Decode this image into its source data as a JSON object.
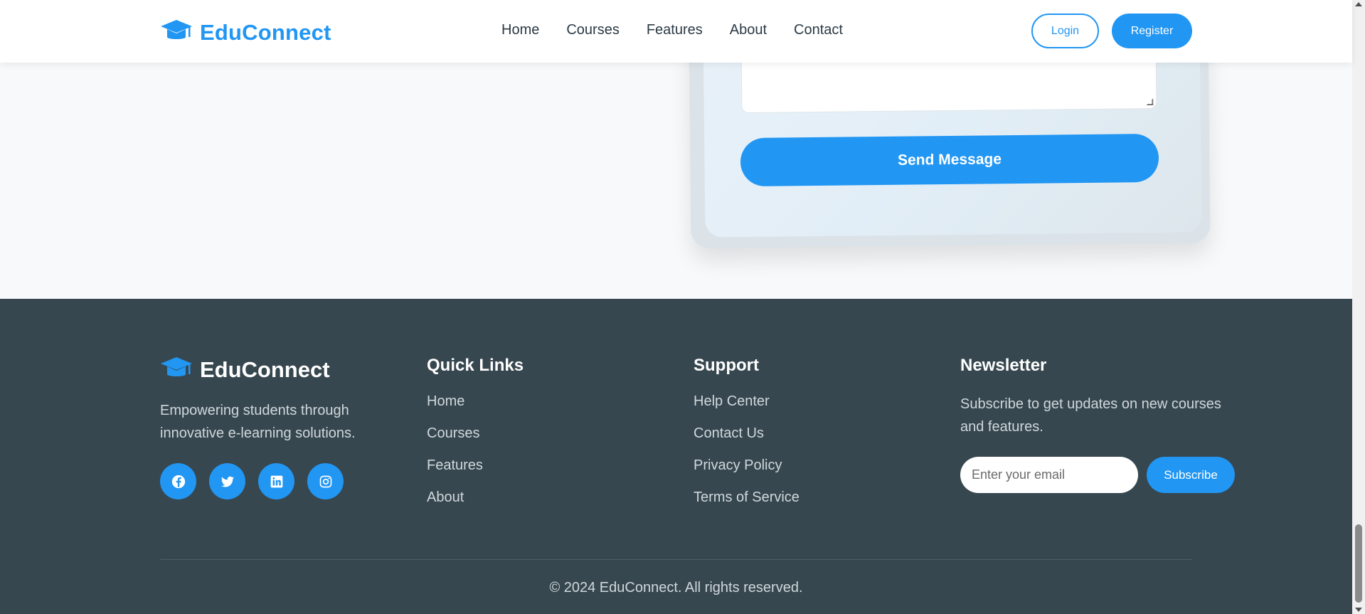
{
  "colors": {
    "accent": "#2196f3",
    "footer_bg": "#37474f",
    "page_bg": "#f7f9fb"
  },
  "header": {
    "brand": "EduConnect",
    "nav": [
      "Home",
      "Courses",
      "Features",
      "About",
      "Contact"
    ],
    "login_label": "Login",
    "register_label": "Register"
  },
  "contact_form": {
    "send_label": "Send Message"
  },
  "footer": {
    "brand": "EduConnect",
    "description": "Empowering students through innovative e-learning solutions.",
    "socials": [
      "facebook-icon",
      "twitter-icon",
      "linkedin-icon",
      "instagram-icon"
    ],
    "quick_links": {
      "title": "Quick Links",
      "items": [
        "Home",
        "Courses",
        "Features",
        "About"
      ]
    },
    "support": {
      "title": "Support",
      "items": [
        "Help Center",
        "Contact Us",
        "Privacy Policy",
        "Terms of Service"
      ]
    },
    "newsletter": {
      "title": "Newsletter",
      "description": "Subscribe to get updates on new courses and features.",
      "placeholder": "Enter your email",
      "button_label": "Subscribe"
    },
    "copyright": "© 2024 EduConnect. All rights reserved."
  }
}
